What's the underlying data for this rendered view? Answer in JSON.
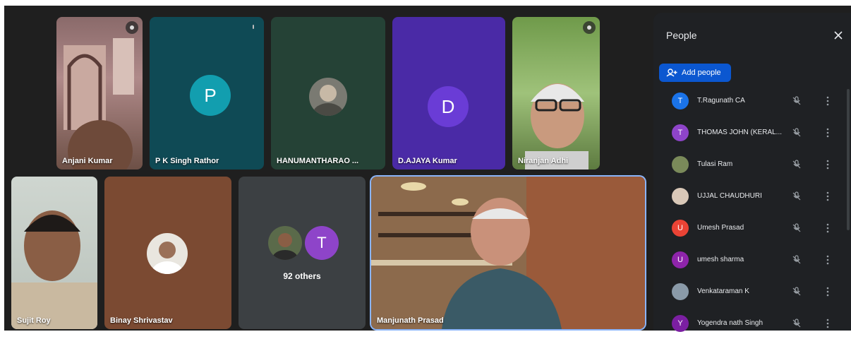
{
  "tiles": {
    "anjani": {
      "name": "Anjani Kumar"
    },
    "pk_singh": {
      "name": "P K Singh Rathor",
      "initial": "P"
    },
    "hanumantharao": {
      "name": "HANUMANTHARAO ..."
    },
    "d_ajaya": {
      "name": "D.AJAYA Kumar",
      "initial": "D"
    },
    "niranjan": {
      "name": "Niranjan Adhi"
    },
    "sujit": {
      "name": "Sujit Roy"
    },
    "binay": {
      "name": "Binay Shrivastav"
    },
    "others": {
      "label": "92 others",
      "initial": "T"
    },
    "manjunath": {
      "name": "Manjunath Prasad"
    }
  },
  "people_panel": {
    "title": "People",
    "add_people_label": "Add people",
    "participants": [
      {
        "name": "T.Ragunath CA",
        "initial": "T",
        "color": "#1a73e8"
      },
      {
        "name": "THOMAS JOHN (KERAL...",
        "initial": "T",
        "color": "#8e44c9"
      },
      {
        "name": "Tulasi Ram",
        "initial": "",
        "color": "#7a8a5a"
      },
      {
        "name": "UJJAL CHAUDHURI",
        "initial": "",
        "color": "#d9c8b8"
      },
      {
        "name": "Umesh Prasad",
        "initial": "U",
        "color": "#ea4335"
      },
      {
        "name": "umesh sharma",
        "initial": "U",
        "color": "#8e24aa"
      },
      {
        "name": "Venkataraman K",
        "initial": "",
        "color": "#8a9aa8"
      },
      {
        "name": "Yogendra nath Singh",
        "initial": "Y",
        "color": "#7b1fa2"
      }
    ]
  },
  "colors": {
    "accent": "#0b57d0",
    "active_border": "#8ab4f8"
  }
}
